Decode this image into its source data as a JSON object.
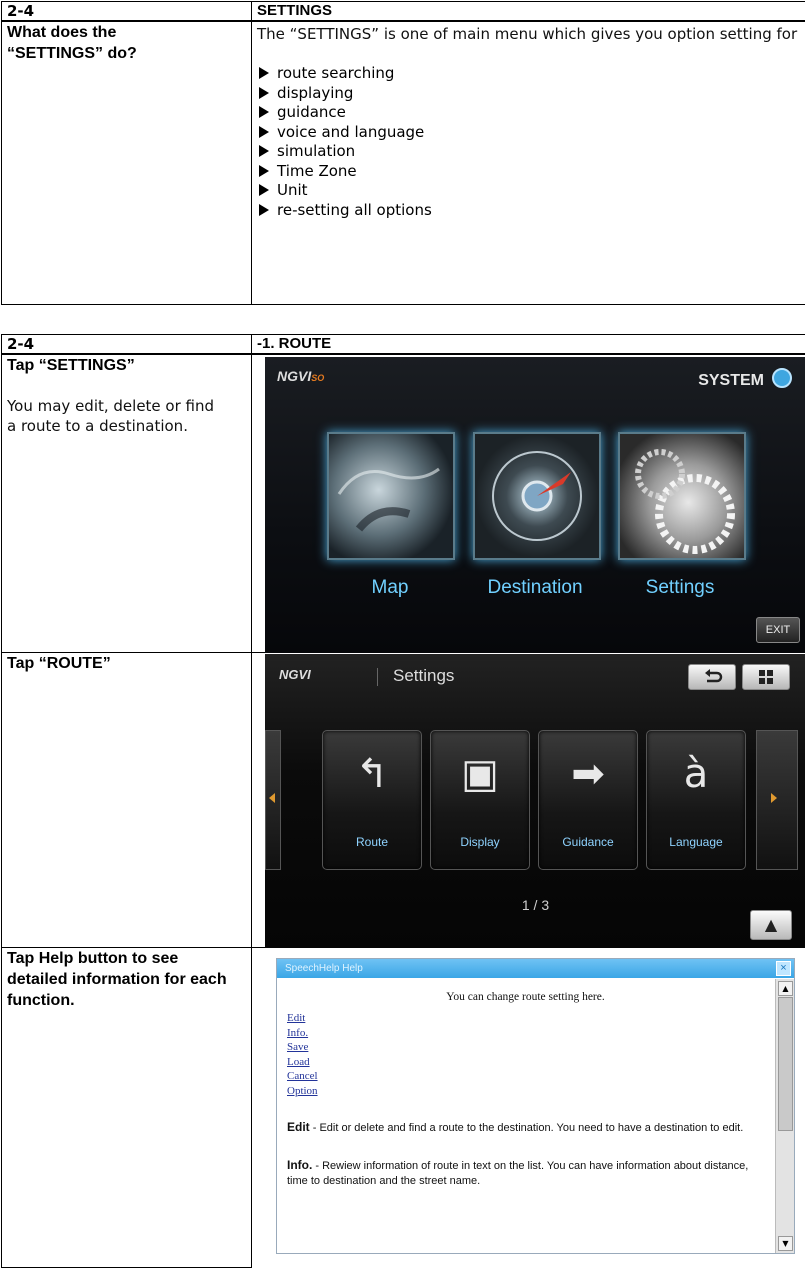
{
  "section1": {
    "num": "2-4",
    "title": "SETTINGS",
    "question": "What does the “SETTINGS” do?",
    "intro": "The “SETTINGS” is one of main menu which gives you option setting for",
    "options": [
      "route searching",
      "displaying",
      "guidance",
      "voice and language",
      "simulation",
      "Time Zone",
      "Unit",
      "re-setting all options"
    ]
  },
  "section2": {
    "num": "2-4",
    "title": "-1. ROUTE",
    "step1_label": "Tap “SETTINGS”",
    "step1_desc": "You may edit, delete or find a route to a destination.",
    "step2_label": "Tap “ROUTE”",
    "step3_label": "Tap Help button to see detailed information for each function."
  },
  "screen_main": {
    "brand": "NGVI",
    "system_label": "SYSTEM",
    "tiles": [
      "Map",
      "Destination",
      "Settings"
    ],
    "exit": "EXIT"
  },
  "screen_settings": {
    "brand": "NGVI",
    "title": "Settings",
    "tiles": [
      "Route",
      "Display",
      "Guidance",
      "Language"
    ],
    "page": "1 / 3"
  },
  "screen_help": {
    "title": "SpeechHelp Help",
    "intro": "You can change route setting here.",
    "links": [
      "Edit",
      "Info.",
      "Save",
      "Load",
      "Cancel",
      "Option"
    ],
    "para1_term": "Edit",
    "para1_text": " - Edit or delete and find a route to the destination. You need to have a destination to edit.",
    "para2_term": "Info.",
    "para2_text": " - Rewiew information of route in text on the list. You can have information about distance, time to destination and the street name."
  },
  "colors": {
    "accent_blue": "#71d0ff",
    "help_bar": "#3aa6e6",
    "orange": "#e47a20"
  }
}
